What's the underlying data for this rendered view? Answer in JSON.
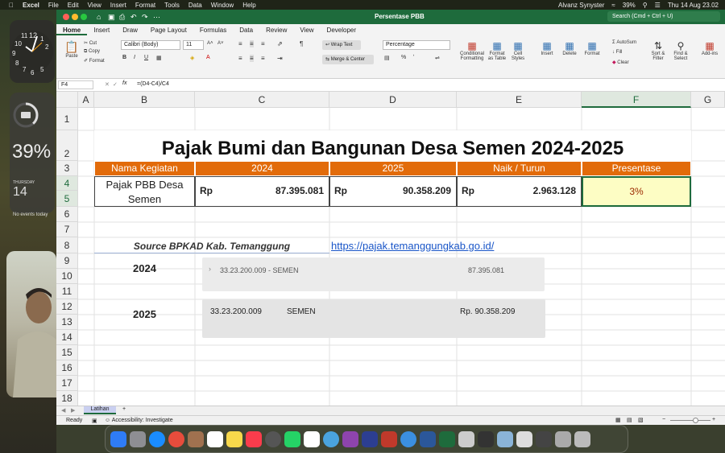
{
  "menubar": {
    "app": "Excel",
    "items": [
      "File",
      "Edit",
      "View",
      "Insert",
      "Format",
      "Tools",
      "Data",
      "Window",
      "Help"
    ],
    "user": "Alvanz Synyster",
    "battery": "39%",
    "datetime": "Thu 14 Aug 23.02"
  },
  "widgets": {
    "battery_percent": "39%",
    "cal_day": "THURSDAY",
    "cal_date": "14",
    "cal_events": "No events today",
    "clock_nums": [
      "12",
      "1",
      "2",
      "10",
      "11",
      "9",
      "8",
      "7",
      "6",
      "5"
    ]
  },
  "window": {
    "title": "Persentase PBB",
    "search_placeholder": "Search (Cmd + Ctrl + U)"
  },
  "ribbon_tabs": [
    "Home",
    "Insert",
    "Draw",
    "Page Layout",
    "Formulas",
    "Data",
    "Review",
    "View",
    "Developer"
  ],
  "ribbon": {
    "paste": "Paste",
    "cut": "Cut",
    "copy": "Copy",
    "format": "Format",
    "font_name": "Calibri (Body)",
    "font_size": "11",
    "wrap_text": "Wrap Text",
    "merge_center": "Merge & Center",
    "number_format": "Percentage",
    "conditional_formatting": "Conditional Formatting",
    "format_as_table": "Format as Table",
    "cell_styles": "Cell Styles",
    "insert": "Insert",
    "delete": "Delete",
    "format_cells": "Format",
    "autosum": "AutoSum",
    "fill": "Fill",
    "clear": "Clear",
    "sort_filter": "Sort & Filter",
    "find_select": "Find & Select",
    "addins": "Add-ins"
  },
  "formula_bar": {
    "cell_ref": "F4",
    "formula": "=(D4-C4)/C4"
  },
  "columns": [
    "A",
    "B",
    "C",
    "D",
    "E",
    "F",
    "G"
  ],
  "rows": [
    "1",
    "2",
    "3",
    "4",
    "5",
    "6",
    "7",
    "8",
    "9",
    "10",
    "11",
    "12",
    "13",
    "14",
    "15",
    "16",
    "17",
    "18"
  ],
  "sheet": {
    "title": "Pajak Bumi dan Bangunan Desa Semen 2024-2025",
    "headers": [
      "Nama Kegiatan",
      "2024",
      "2025",
      "Naik / Turun",
      "Presentase"
    ],
    "row_name": "Pajak PBB Desa Semen",
    "currency": "Rp",
    "v2024": "87.395.081",
    "v2025": "90.358.209",
    "diff": "2.963.128",
    "percent": "3%",
    "source": "Source BPKAD Kab. Temanggung",
    "link": "https://pajak.temanggungkab.go.id/",
    "label_2024": "2024",
    "label_2025": "2025",
    "img1_code": "33.23.200.009 - SEMEN",
    "img1_value": "87.395.081",
    "img2_code": "33.23.200.009",
    "img2_name": "SEMEN",
    "img2_value": "Rp. 90.358.209"
  },
  "sheet_tabs": [
    "Latihan"
  ],
  "status": {
    "ready": "Ready",
    "accessibility": "Accessibility: Investigate"
  },
  "colors": {
    "excel_green": "#1e6b3c",
    "header_orange": "#e26b0a",
    "percent_fill": "#fdfdc4",
    "link_blue": "#1a56c8"
  }
}
